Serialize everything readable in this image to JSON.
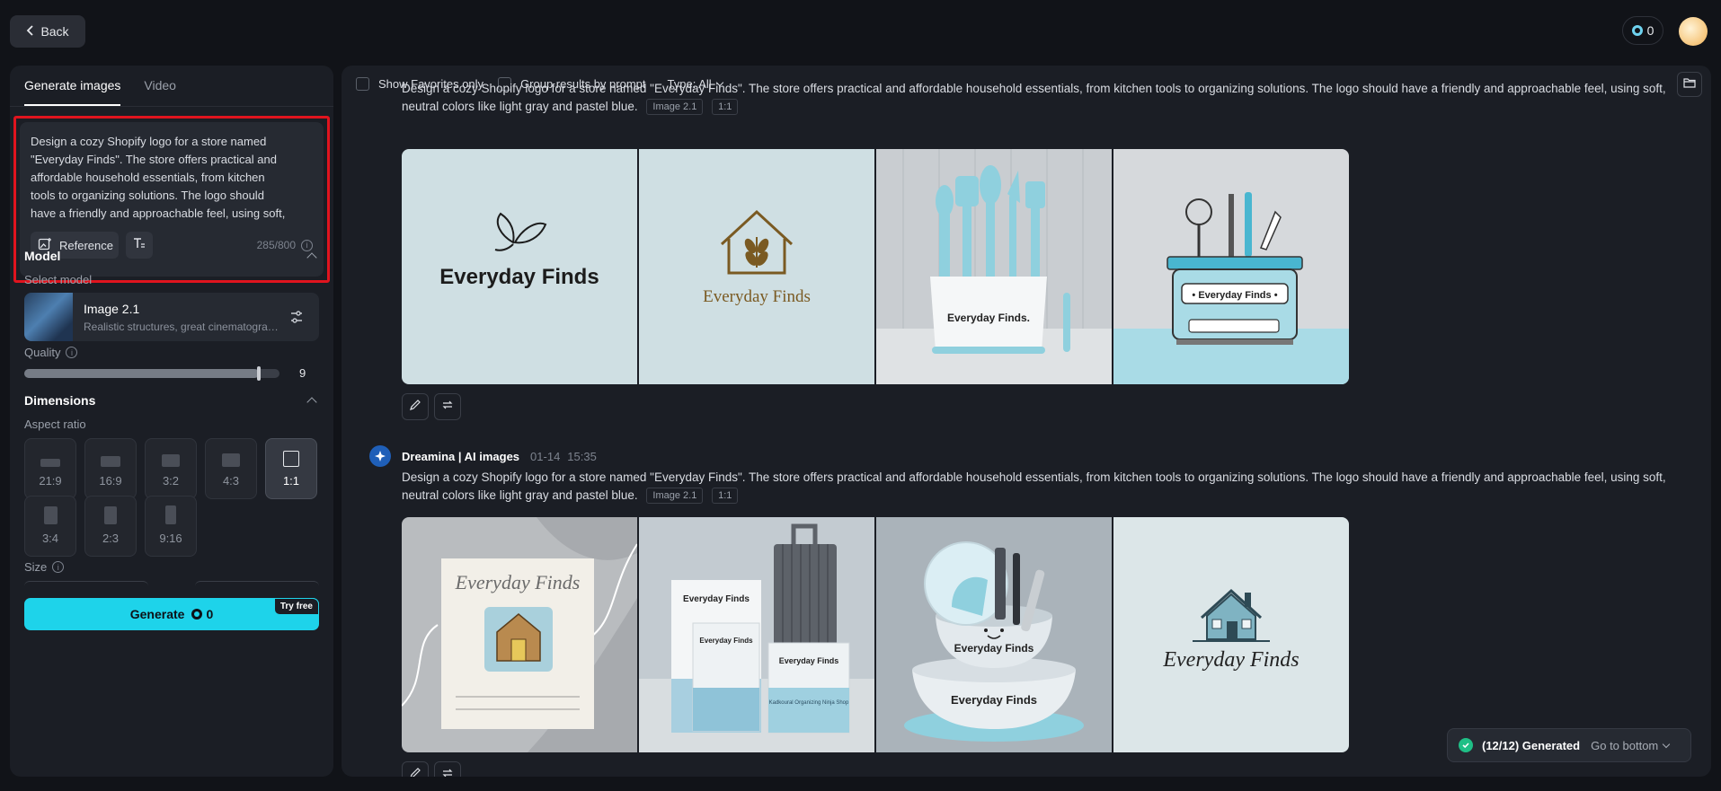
{
  "topbar": {
    "back_label": "Back",
    "credits": "0"
  },
  "left": {
    "tabs": [
      "Generate images",
      "Video"
    ],
    "prompt": "Design a cozy Shopify logo for a store named \"Everyday Finds\". The store offers practical and affordable household essentials, from kitchen tools to organizing solutions. The logo should have a friendly and approachable feel, using soft, neutral colors like light gray and pastel blue.",
    "reference_label": "Reference",
    "char_count": "285/800",
    "model_section": "Model",
    "select_model_label": "Select model",
    "model_name": "Image 2.1",
    "model_desc": "Realistic structures, great cinematography",
    "quality_label": "Quality",
    "quality_value": "9",
    "quality_level": 0.92,
    "dimensions_section": "Dimensions",
    "aspect_ratio_label": "Aspect ratio",
    "ratios": [
      "21:9",
      "16:9",
      "3:2",
      "4:3",
      "1:1",
      "3:4",
      "2:3",
      "9:16"
    ],
    "selected_ratio": "1:1",
    "size_label": "Size",
    "generate_label": "Generate",
    "generate_cost": "0",
    "try_free_label": "Try free"
  },
  "main": {
    "toolbar": {
      "favorites_label": "Show Favorites only",
      "group_label": "Group results by prompt",
      "type_label": "Type: All"
    },
    "groups": [
      {
        "prompt": "Design a cozy Shopify logo for a store named \"Everyday Finds\". The store offers practical and affordable household essentials, from kitchen tools to organizing solutions. The logo should have a friendly and approachable feel, using soft, neutral colors like light gray and pastel blue.",
        "model_tag": "Image 2.1",
        "ratio_tag": "1:1",
        "images": [
          {
            "text": "Everyday Finds",
            "kind": "leaf-logo"
          },
          {
            "text": "Everyday Finds",
            "kind": "house-leaf-logo"
          },
          {
            "text": "Everyday Finds.",
            "kind": "utensil-holder"
          },
          {
            "text": "• Everyday Finds •",
            "kind": "kitchen-caddy"
          }
        ]
      },
      {
        "author": "Dreamina | AI images",
        "date": "01-14",
        "time": "15:35",
        "prompt": "Design a cozy Shopify logo for a store named \"Everyday Finds\". The store offers practical and affordable household essentials, from kitchen tools to organizing solutions. The logo should have a friendly and approachable feel, using soft, neutral colors like light gray and pastel blue.",
        "model_tag": "Image 2.1",
        "ratio_tag": "1:1",
        "images": [
          {
            "text": "Everyday Finds",
            "kind": "card-house"
          },
          {
            "text": "Everyday Finds",
            "kind": "packaging",
            "texts": [
              "Everyday Finds",
              "Everyday Finds",
              "Everyday Finds",
              "Everyday Finds",
              "Kadkoural Organizing Ninja Shop"
            ]
          },
          {
            "text": "Everyday Finds",
            "kind": "bowl-stack",
            "texts": [
              "Everyday Finds",
              "Everyday Finds"
            ]
          },
          {
            "text": "Everyday Finds",
            "kind": "house-script-logo"
          }
        ]
      }
    ],
    "status": {
      "generated_label": "(12/12) Generated",
      "goto_label": "Go to bottom"
    }
  },
  "colors": {
    "accent": "#1ed3ea",
    "highlight_border": "#e0141e",
    "pastel_blue": "#8fd0de",
    "panel": "#1b1e25"
  }
}
